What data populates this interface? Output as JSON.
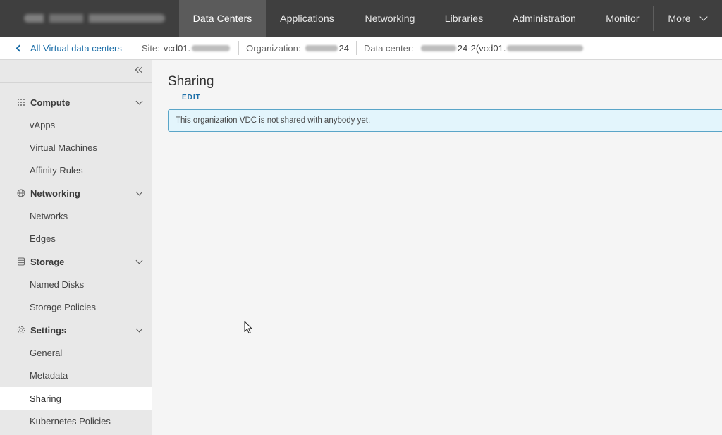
{
  "topnav": {
    "tabs": [
      {
        "label": "Data Centers",
        "active": true
      },
      {
        "label": "Applications",
        "active": false
      },
      {
        "label": "Networking",
        "active": false
      },
      {
        "label": "Libraries",
        "active": false
      },
      {
        "label": "Administration",
        "active": false
      },
      {
        "label": "Monitor",
        "active": false
      }
    ],
    "more_label": "More"
  },
  "breadcrumb": {
    "back_label": "All Virtual data centers",
    "site_label": "Site:",
    "site_value": "vcd01.",
    "org_label": "Organization:",
    "org_value_suffix": "24",
    "dc_label": "Data center:",
    "dc_value": "24-2(vcd01."
  },
  "sidebar": {
    "groups": [
      {
        "label": "Compute",
        "icon": "grid-icon",
        "items": [
          "vApps",
          "Virtual Machines",
          "Affinity Rules"
        ]
      },
      {
        "label": "Networking",
        "icon": "globe-icon",
        "items": [
          "Networks",
          "Edges"
        ]
      },
      {
        "label": "Storage",
        "icon": "database-icon",
        "items": [
          "Named Disks",
          "Storage Policies"
        ]
      },
      {
        "label": "Settings",
        "icon": "gear-icon",
        "items": [
          "General",
          "Metadata",
          "Sharing",
          "Kubernetes Policies"
        ]
      }
    ],
    "active_item": "Sharing"
  },
  "main": {
    "title": "Sharing",
    "edit_label": "EDIT",
    "alert_text": "This organization VDC is not shared with anybody yet."
  },
  "colors": {
    "nav_bg": "#3f3f3f",
    "nav_active": "#5b5b5b",
    "link": "#1b6ea8",
    "alert_bg": "#e3f5fc",
    "alert_border": "#5aa5c8"
  }
}
